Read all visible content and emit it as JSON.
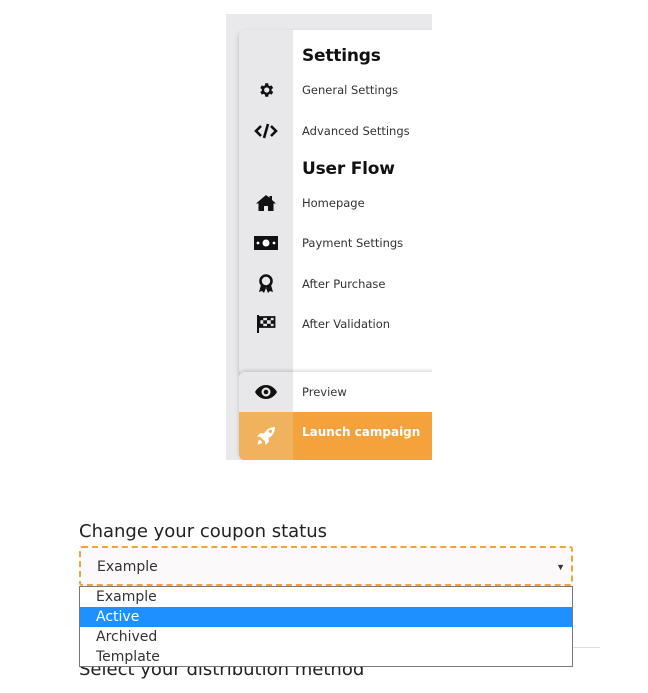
{
  "sidebar": {
    "settings_title": "Settings",
    "settings_items": [
      {
        "label": "General Settings",
        "icon": "gear-icon"
      },
      {
        "label": "Advanced Settings",
        "icon": "code-icon"
      }
    ],
    "userflow_title": "User Flow",
    "userflow_items": [
      {
        "label": "Homepage",
        "icon": "home-icon"
      },
      {
        "label": "Payment Settings",
        "icon": "money-icon"
      },
      {
        "label": "After Purchase",
        "icon": "award-icon"
      },
      {
        "label": "After Validation",
        "icon": "checkered-flag-icon"
      }
    ],
    "preview_label": "Preview",
    "launch_label": "Launch campaign"
  },
  "form": {
    "status_label": "Change your coupon status",
    "status_value": "Example",
    "options": [
      "Example",
      "Active",
      "Archived",
      "Template"
    ],
    "highlighted_option": "Active",
    "next_label": "Select your distribution method"
  },
  "colors": {
    "accent": "#f3a23c",
    "highlight": "#1e90ff"
  }
}
